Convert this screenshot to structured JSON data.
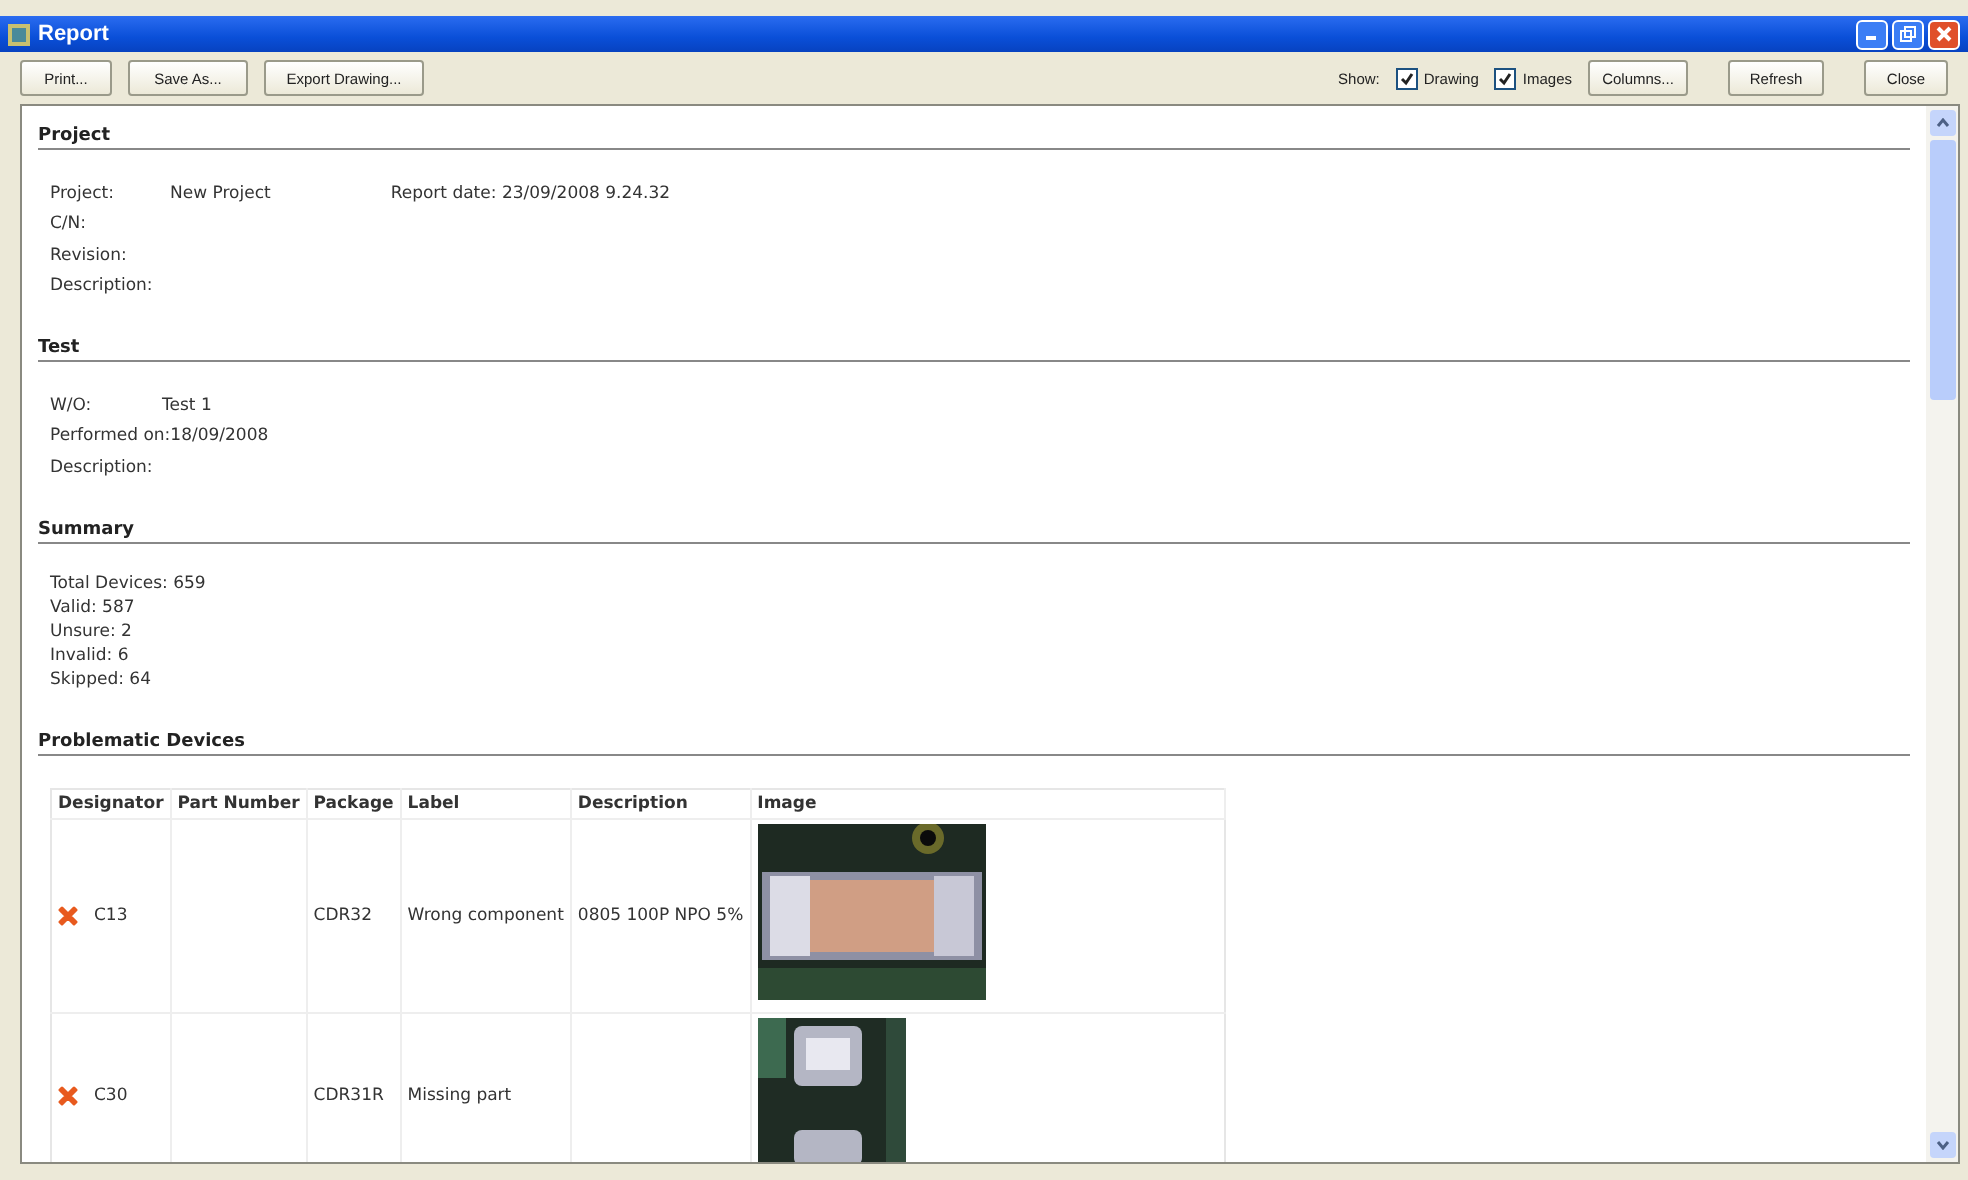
{
  "window": {
    "title": "Report"
  },
  "toolbar": {
    "left_buttons": [
      "Print...",
      "Save As...",
      "Export Drawing..."
    ],
    "show_label": "Show:",
    "checkboxes": [
      {
        "label": "Drawing",
        "checked": true
      },
      {
        "label": "Images",
        "checked": true
      }
    ],
    "right_buttons": [
      "Columns...",
      "Refresh",
      "Close"
    ]
  },
  "sections": [
    {
      "title": "Project",
      "kind": "fields",
      "fields": [
        {
          "label": "Project:",
          "value": "New Project",
          "aside": "Report date: 23/09/2008 9.24.32"
        },
        {
          "label": "C/N:"
        },
        {
          "label": "Revision:"
        },
        {
          "label": "Description:"
        }
      ]
    },
    {
      "title": "Test",
      "kind": "fields",
      "fields": [
        {
          "label": "W/O:",
          "value": "Test 1"
        },
        {
          "label": "Performed on:",
          "value": "18/09/2008"
        },
        {
          "label": "Description:"
        }
      ]
    },
    {
      "title": "Summary",
      "kind": "lines",
      "lines": [
        "Total Devices: 659",
        "Valid: 587",
        "Unsure: 2",
        "Invalid: 6",
        "Skipped: 64"
      ]
    },
    {
      "title": "Problematic Devices",
      "kind": "table",
      "columns": [
        "Designator",
        "Part Number",
        "Package",
        "Label",
        "Description",
        "Image"
      ],
      "rows": [
        {
          "designator": "C13",
          "package": "CDR32",
          "label": "Wrong component",
          "description": "0805 100P NPO 5%"
        },
        {
          "designator": "C30",
          "package": "CDR31R",
          "label": "Missing part"
        }
      ]
    }
  ]
}
